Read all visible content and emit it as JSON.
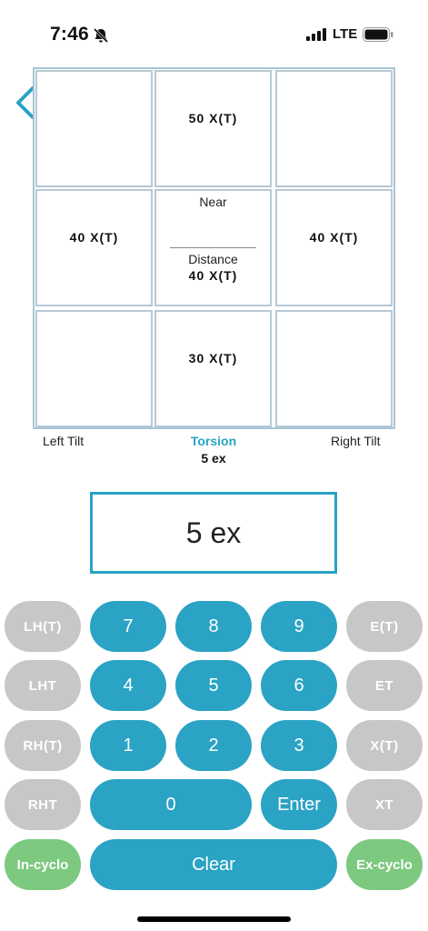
{
  "status": {
    "time": "7:46",
    "network": "LTE"
  },
  "grid": {
    "top_center": "50 X(T)",
    "middle_left": "40 X(T)",
    "middle_right": "40 X(T)",
    "center_near_label": "Near",
    "center_distance_label": "Distance",
    "center_distance_value": "40 X(T)",
    "bottom_center": "30 X(T)"
  },
  "tilt": {
    "left_label": "Left Tilt",
    "right_label": "Right Tilt",
    "torsion_label": "Torsion",
    "torsion_value": "5 ex"
  },
  "display_value": "5 ex",
  "keys": {
    "lht_paren": "LH(T)",
    "lht": "LHT",
    "rht_paren": "RH(T)",
    "rht": "RHT",
    "et_paren": "E(T)",
    "et": "ET",
    "xt_paren": "X(T)",
    "xt": "XT",
    "d7": "7",
    "d8": "8",
    "d9": "9",
    "d4": "4",
    "d5": "5",
    "d6": "6",
    "d1": "1",
    "d2": "2",
    "d3": "3",
    "d0": "0",
    "enter": "Enter",
    "clear": "Clear",
    "incyclo": "In-cyclo",
    "excyclo": "Ex-cyclo"
  },
  "colors": {
    "accent": "#2aa3c4",
    "gray_key": "#c7c7c7",
    "green_key": "#7cc97f",
    "grid_border": "#b7c9d6"
  }
}
